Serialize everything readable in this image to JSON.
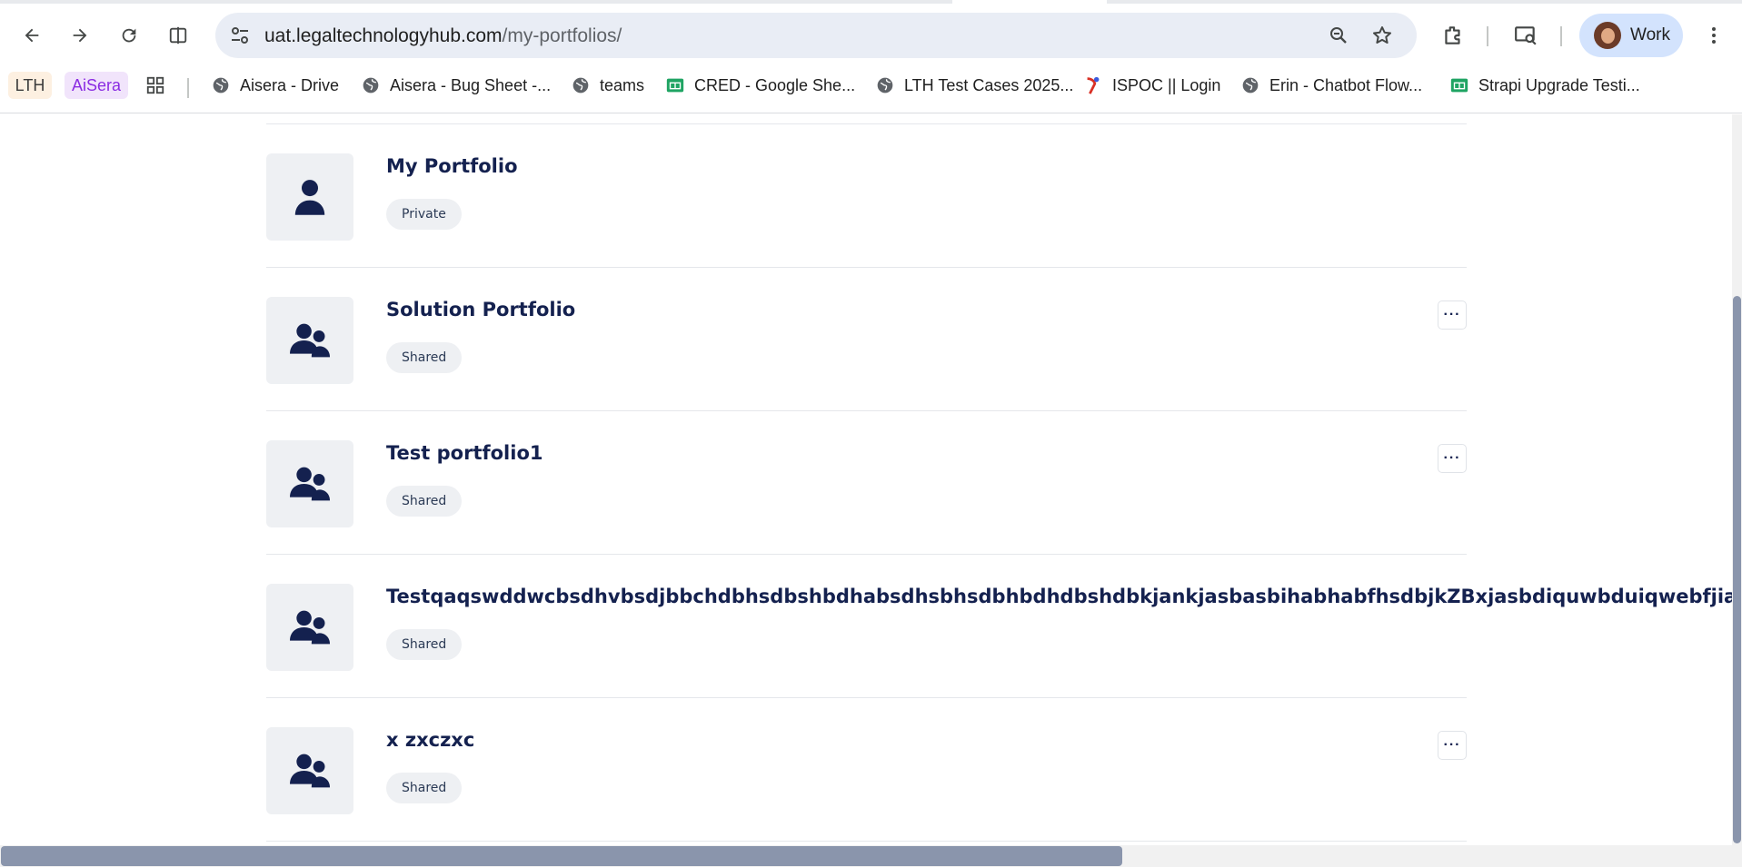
{
  "browser": {
    "url_host": "uat.legaltechnologyhub.com",
    "url_path": "/my-portfolios/",
    "profile_label": "Work",
    "icons": {
      "back": "arrow-left-icon",
      "forward": "arrow-right-icon",
      "reload": "reload-icon",
      "split": "split-view-icon",
      "site_info": "tune-icon",
      "zoom": "zoom-icon",
      "bookmark": "star-icon",
      "extensions": "puzzle-icon",
      "cast": "cast-search-icon",
      "menu": "kebab-menu-icon"
    }
  },
  "bookmarks": {
    "pills": [
      {
        "label": "LTH",
        "bg": "#fdf0e1",
        "color": "#3c3c3c"
      },
      {
        "label": "AiSera",
        "bg": "#f1e4fb",
        "color": "#8a2be2"
      }
    ],
    "items": [
      {
        "label": "Aisera - Drive",
        "icon": "globe-icon"
      },
      {
        "label": "Aisera - Bug Sheet -...",
        "icon": "globe-icon"
      },
      {
        "label": "teams",
        "icon": "globe-icon"
      },
      {
        "label": "CRED - Google She...",
        "icon": "sheets-icon"
      },
      {
        "label": "LTH Test Cases 2025...",
        "icon": "globe-icon"
      },
      {
        "label": "ISPOC || Login",
        "icon": "ispoc-icon"
      },
      {
        "label": "Erin - Chatbot Flow...",
        "icon": "globe-icon"
      },
      {
        "label": "Strapi Upgrade Testi...",
        "icon": "sheets-icon"
      }
    ]
  },
  "portfolios": [
    {
      "title": "My Portfolio",
      "badge": "Private",
      "icon": "user-icon",
      "has_menu": false
    },
    {
      "title": "Solution Portfolio",
      "badge": "Shared",
      "icon": "users-icon",
      "has_menu": true
    },
    {
      "title": "Test portfolio1",
      "badge": "Shared",
      "icon": "users-icon",
      "has_menu": true
    },
    {
      "title": "TestqaqswddwcbsdhvbsdjbbchdbhsdbshbdhabsdhsbhsdbhbdhdbshdbkjankjasbasbihabhabfhsdbjkZBxjasbdiquwbduiqwebfjiasbc",
      "badge": "Shared",
      "icon": "users-icon",
      "has_menu": false
    },
    {
      "title": "x zxczxc",
      "badge": "Shared",
      "icon": "users-icon",
      "has_menu": true
    }
  ],
  "more_label": "···",
  "colors": {
    "title": "#14214f",
    "icon": "#14214f",
    "thumb_bg": "#eef0f3",
    "badge_bg": "#eef0f3",
    "scroll_thumb": "#8a95ac"
  }
}
